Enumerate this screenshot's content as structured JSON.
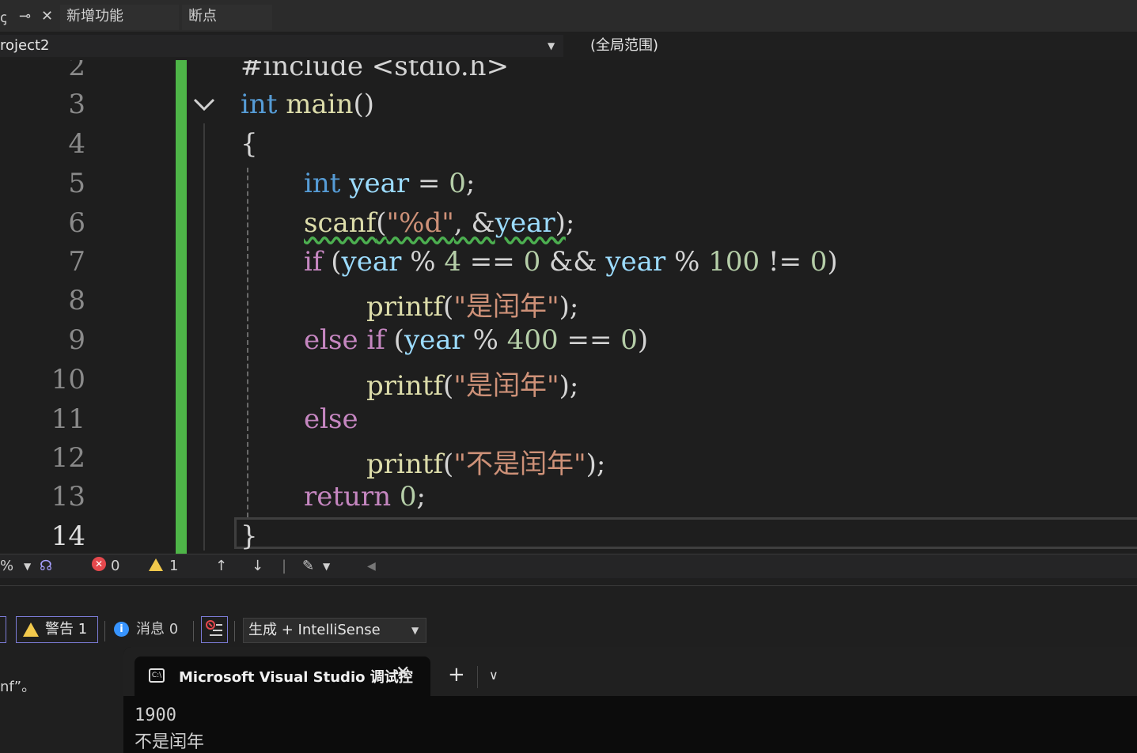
{
  "tabstrip": {
    "controls": [
      "ꞔ",
      "⊸",
      "✕"
    ],
    "tabs": [
      "新增功能",
      "断点"
    ]
  },
  "navbar": {
    "project": "roject2",
    "scope": "(全局范围)"
  },
  "editor": {
    "line_numbers": [
      "2",
      "3",
      "4",
      "5",
      "6",
      "7",
      "8",
      "9",
      "10",
      "11",
      "12",
      "13",
      "14"
    ],
    "partial_first_line": "#include <stdio.h>"
  },
  "editor_status": {
    "zoom": "%",
    "errors": "0",
    "warnings": "1"
  },
  "error_list": {
    "warnings_label": "警告 1",
    "messages_label": "消息 0",
    "source_filter": "生成 + IntelliSense",
    "row_description": "nf”。"
  },
  "terminal": {
    "tab_title": "Microsoft Visual Studio 调试控",
    "output_lines": [
      "1900",
      "不是闰年"
    ]
  },
  "colors": {
    "keyword": "#569cd6",
    "control": "#c586c0",
    "function": "#dcdcaa",
    "variable": "#9cdcfe",
    "number": "#b5cea8",
    "string": "#ce9178",
    "change_bar": "#4eb548"
  }
}
